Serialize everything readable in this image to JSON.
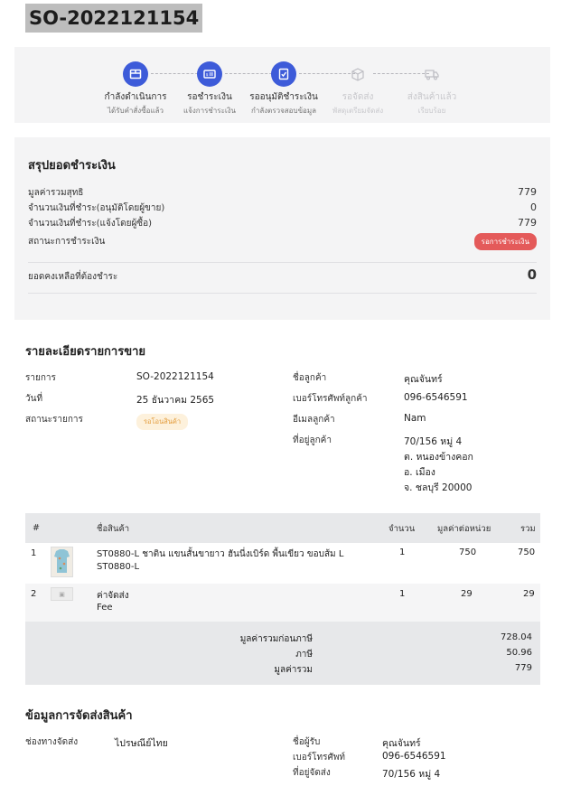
{
  "order": {
    "number": "SO-2022121154"
  },
  "stepper": {
    "steps": [
      {
        "label": "กำลังดำเนินการ",
        "sub": "ได้รับคำสั่งซื้อแล้ว",
        "icon": "box-icon",
        "state": "active"
      },
      {
        "label": "รอชำระเงิน",
        "sub": "แจ้งการชำระเงิน",
        "icon": "payment-card-icon",
        "state": "active"
      },
      {
        "label": "รออนุมัติชำระเงิน",
        "sub": "กำลังตรวจสอบข้อมูล",
        "icon": "document-check-icon",
        "state": "active"
      },
      {
        "label": "รอจัดส่ง",
        "sub": "พัสดุเตรียมจัดส่ง",
        "icon": "package-icon",
        "state": "inactive"
      },
      {
        "label": "ส่งสินค้าแล้ว",
        "sub": "เรียบร้อย",
        "icon": "truck-icon",
        "state": "inactive"
      }
    ],
    "active_color": "#3d5bd9"
  },
  "summary": {
    "title": "สรุปยอดชำระเงิน",
    "rows": [
      {
        "label": "มูลค่ารวมสุทธิ",
        "value": "779"
      },
      {
        "label": "จำนวนเงินที่ชำระ(อนุมัติโดยผู้ขาย)",
        "value": "0"
      },
      {
        "label": "จำนวนเงินที่ชำระ(แจ้งโดยผู้ซื้อ)",
        "value": "779"
      }
    ],
    "status_label": "สถานะการชำระเงิน",
    "status_badge": "รอการชำระเงิน",
    "status_color": "#e45a5a",
    "balance_label": "ยอดคงเหลือที่ต้องชำระ",
    "balance_value": "0"
  },
  "details": {
    "title": "รายละเอียดรายการขาย",
    "item_label": "รายการ",
    "item_value": "SO-2022121154",
    "date_label": "วันที่",
    "date_value": "25 ธันวาคม 2565",
    "status_label": "สถานะรายการ",
    "status_badge": "รอโอนสินค้า",
    "customer_name_label": "ชื่อลูกค้า",
    "customer_name": "คุณจันทร์",
    "phone_label": "เบอร์โทรศัพท์ลูกค้า",
    "phone": "096-6546591",
    "email_label": "อีเมลลูกค้า",
    "email": "Nam",
    "address_label": "ที่อยู่ลูกค้า",
    "address_lines": [
      "70/156 หมู่ 4",
      "ต. หนองข้างคอก",
      "อ. เมือง",
      "จ. ชลบุรี 20000"
    ]
  },
  "table": {
    "headers": {
      "index": "#",
      "name": "ชื่อสินค้า",
      "qty": "จำนวน",
      "unit_price": "มูลค่าต่อหน่วย",
      "total": "รวม"
    },
    "rows": [
      {
        "index": "1",
        "name": "ST0880-L ชาติน แขนสั้นขายาว ฮันนี่งเบิร์ด พื้นเขียว ขอบส้ม L",
        "sku": "ST0880-L",
        "qty": "1",
        "unit_price": "750",
        "total": "750"
      },
      {
        "index": "2",
        "name": "ค่าจัดส่ง",
        "sku": "Fee",
        "qty": "1",
        "unit_price": "29",
        "total": "29"
      }
    ],
    "totals": [
      {
        "label": "มูลค่ารวมก่อนภาษี",
        "value": "728.04"
      },
      {
        "label": "ภาษี",
        "value": "50.96"
      },
      {
        "label": "มูลค่ารวม",
        "value": "779"
      }
    ]
  },
  "shipping": {
    "title": "ข้อมูลการจัดส่งสินค้า",
    "channel_label": "ช่องทางจัดส่ง",
    "channel": "ไปรษณีย์ไทย",
    "recipient_label": "ชื่อผู้รับ",
    "recipient": "คุณจันทร์",
    "phone_label": "เบอร์โทรศัพท์",
    "phone": "096-6546591",
    "address_label": "ที่อยู่จัดส่ง",
    "address_line1": "70/156 หมู่ 4"
  }
}
